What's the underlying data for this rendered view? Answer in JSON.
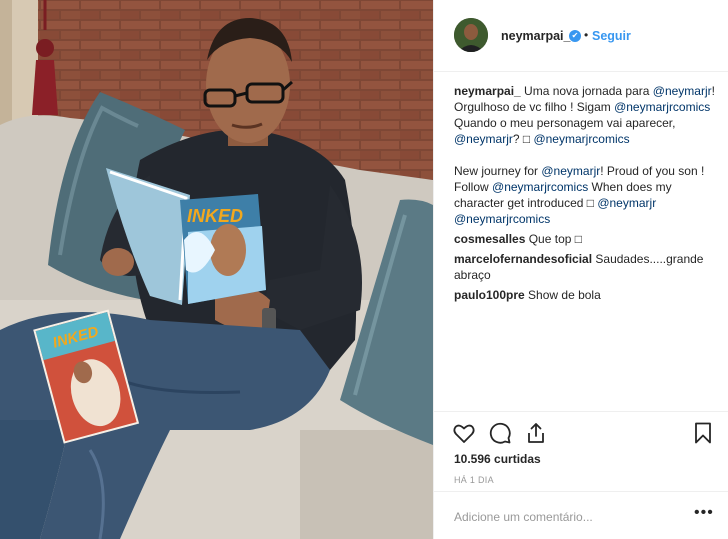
{
  "header": {
    "username": "neymarpai_",
    "separator": "•",
    "follow_label": "Seguir"
  },
  "icons": {
    "verified": "verified-check-icon",
    "like": "heart-icon",
    "comment": "comment-bubble-icon",
    "share": "share-icon",
    "save": "bookmark-icon",
    "more": "more-options-icon"
  },
  "caption": {
    "username": "neymarpai_",
    "p1_text1": " Uma nova jornada para ",
    "p1_mention1": "@neymarjr",
    "p1_text2": "! Orgulhoso de vc filho ! Sigam ",
    "p1_mention2": "@neymarjrcomics",
    "p1_text3": " Quando o meu personagem vai aparecer, ",
    "p1_mention3": "@neymarjr",
    "p1_text4": "? □ ",
    "p1_mention4": "@neymarjrcomics",
    "p2_text1": "New journey for ",
    "p2_mention1": "@neymarjr",
    "p2_text2": "! Proud of you son ! Follow ",
    "p2_mention2": "@neymarjrcomics",
    "p2_text3": " When does my character get introduced □ ",
    "p2_mention3": "@neymarjr",
    "p2_text4": " ",
    "p2_mention4": "@neymarjrcomics"
  },
  "comments": [
    {
      "user": "cosmesalles",
      "text": " Que top □"
    },
    {
      "user": "marcelofernandesoficial",
      "text": " Saudades.....grande abraço"
    },
    {
      "user": "paulo100pre",
      "text": " Show de bola"
    }
  ],
  "likes_label": "10.596 curtidas",
  "timestamp": "HÁ 1 DIA",
  "add_comment_placeholder": "Adicione um comentário...",
  "more_label": "•••",
  "colors": {
    "mention": "#003569",
    "follow": "#3897f0",
    "verified": "#3897f0",
    "muted": "#999999"
  },
  "photo": {
    "comic_title": "INKED"
  }
}
